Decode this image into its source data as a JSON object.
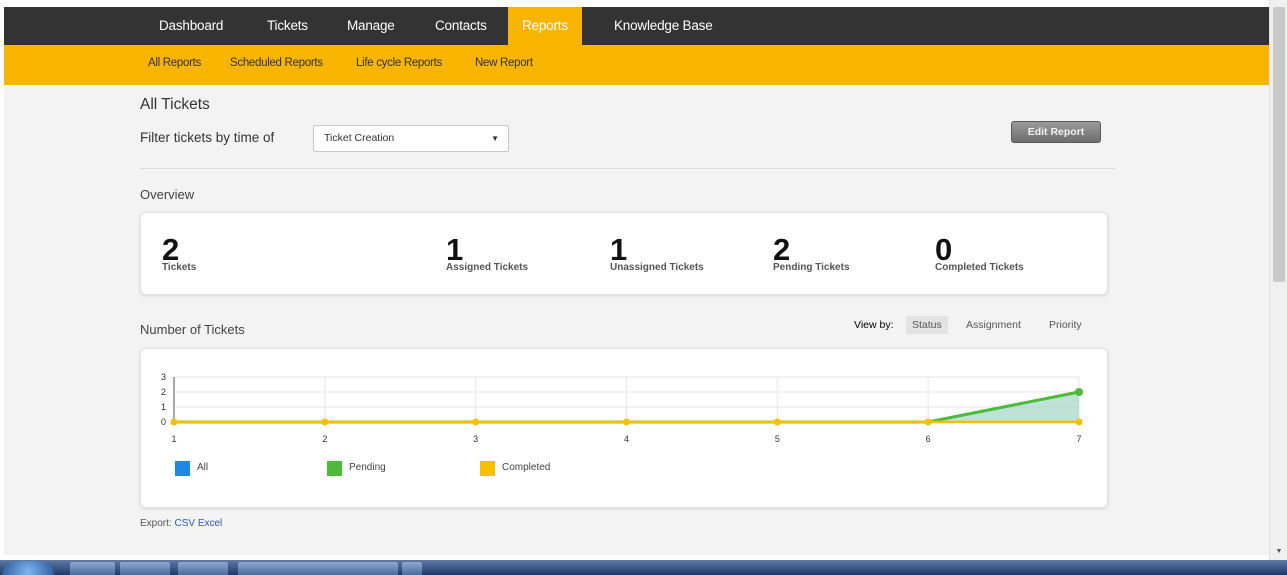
{
  "nav": {
    "items": [
      {
        "label": "Dashboard"
      },
      {
        "label": "Tickets"
      },
      {
        "label": "Manage"
      },
      {
        "label": "Contacts"
      },
      {
        "label": "Reports",
        "active": true
      },
      {
        "label": "Knowledge Base"
      }
    ]
  },
  "subnav": {
    "items": [
      {
        "label": "All Reports"
      },
      {
        "label": "Scheduled Reports"
      },
      {
        "label": "Life cycle Reports"
      },
      {
        "label": "New Report"
      }
    ]
  },
  "page": {
    "title": "All Tickets",
    "filter_label": "Filter tickets by time of",
    "filter_value": "Ticket Creation",
    "edit_button": "Edit Report"
  },
  "overview": {
    "title": "Overview",
    "stats": [
      {
        "value": "2",
        "label": "Tickets"
      },
      {
        "value": "1",
        "label": "Assigned Tickets"
      },
      {
        "value": "1",
        "label": "Unassigned Tickets"
      },
      {
        "value": "2",
        "label": "Pending Tickets"
      },
      {
        "value": "0",
        "label": "Completed Tickets"
      }
    ]
  },
  "tickets_chart": {
    "title": "Number of Tickets",
    "view_by_label": "View by:",
    "view_by_options": [
      {
        "label": "Status",
        "active": true
      },
      {
        "label": "Assignment"
      },
      {
        "label": "Priority"
      }
    ]
  },
  "chart_data": {
    "type": "area",
    "x": [
      1,
      2,
      3,
      4,
      5,
      6,
      7
    ],
    "xticks": [
      "1",
      "2",
      "3",
      "4",
      "5",
      "6",
      "7"
    ],
    "yticks": [
      "0",
      "1",
      "2",
      "3"
    ],
    "ylim": [
      0,
      3
    ],
    "grid": true,
    "legend_placement": "bottom",
    "series": [
      {
        "name": "All",
        "color": "#1e88e5",
        "values": [
          0,
          0,
          0,
          0,
          0,
          0,
          2
        ]
      },
      {
        "name": "Pending",
        "color": "#4cbb3a",
        "values": [
          0,
          0,
          0,
          0,
          0,
          0,
          2
        ]
      },
      {
        "name": "Completed",
        "color": "#f5c000",
        "values": [
          0,
          0,
          0,
          0,
          0,
          0,
          0
        ]
      }
    ]
  },
  "export": {
    "label": "Export:",
    "csv": "CSV",
    "excel": "Excel"
  },
  "colors": {
    "nav_bg": "#333333",
    "accent": "#f7b500",
    "content_bg": "#f3f3f3"
  }
}
